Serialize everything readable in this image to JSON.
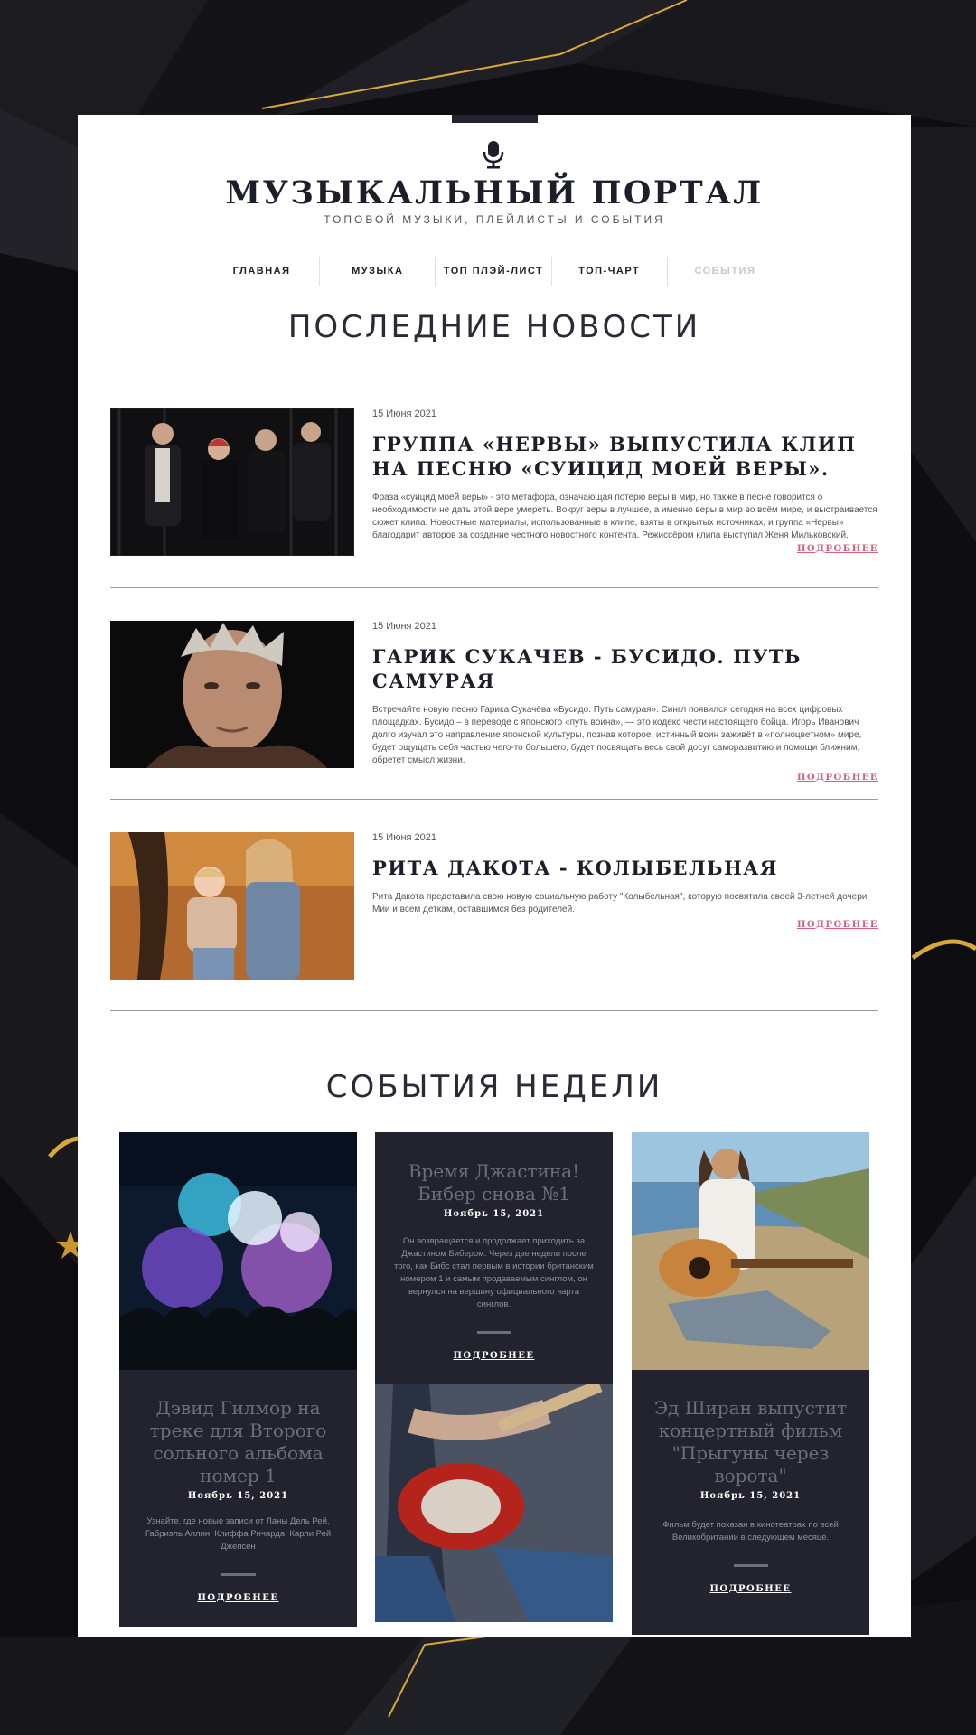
{
  "header": {
    "title": "МУЗЫКАЛЬНЫЙ ПОРТАЛ",
    "subtitle": "ТОПОВОЙ МУЗЫКИ, ПЛЕЙЛИСТЫ И СОБЫТИЯ"
  },
  "nav": {
    "items": [
      {
        "label": "ГЛАВНАЯ"
      },
      {
        "label": "МУЗЫКА"
      },
      {
        "label": "ТОП ПЛЭЙ-ЛИСТ"
      },
      {
        "label": "ТОП-ЧАРТ"
      },
      {
        "label": "СОБЫТИЯ"
      }
    ]
  },
  "news": {
    "section_title": "ПОСЛЕДНИЕ НОВОСТИ",
    "items": [
      {
        "date": "15 Июня 2021",
        "title": "ГРУППА «НЕРВЫ» ВЫПУСТИЛА КЛИП НА ПЕСНЮ «СУИЦИД МОЕЙ ВЕРЫ».",
        "text": "Фраза «суицид моей веры» - это метафора, означающая потерю веры в мир, но также в песне говорится о необходимости не дать этой вере умереть. Вокруг веры в лучшее, а именно веры в мир во всём мире, и выстраивается сюжет клипа. Новостные материалы, использованные в клипе, взяты в открытых источниках, и группа «Нервы» благодарит авторов за создание честного новостного контента. Режиссёром клипа выступил Женя Мильковский.",
        "more": "ПОДРОБНЕЕ",
        "image": "band-photo"
      },
      {
        "date": "15 Июня 2021",
        "title": "ГАРИК СУКАЧЕВ - БУСИДО. ПУТЬ САМУРАЯ",
        "text": "Встречайте новую песню Гарика Сукачёва «Бусидо. Путь самурая». Сингл появился сегодня на всех цифровых площадках. Бусидо – в переводе с японского «путь воина», — это кодекс чести настоящего бойца. Игорь Иванович долго изучал это направление японской культуры, познав которое, истинный воин заживёт в «полноцветном» мире, будет ощущать себя частью чего-то большего, будет посвящать весь свой досуг саморазвитию и помощи ближним, обретет смысл жизни.",
        "more": "ПОДРОБНЕЕ",
        "image": "portrait-photo"
      },
      {
        "date": "15 Июня 2021",
        "title": "РИТА ДАКОТА - КОЛЫБЕЛЬНАЯ",
        "text": "Рита Дакота представила свою новую социальную работу \"Колыбельная\", которую посвятила своей 3-летней дочери Мии и всем деткам, оставшимся без родителей.",
        "more": "ПОДРОБНЕЕ",
        "image": "mother-daughter-photo"
      }
    ]
  },
  "events": {
    "section_title": "СОБЫТИЯ НЕДЕЛИ",
    "items": [
      {
        "title": "Дэвид Гилмор на треке для Второго сольного альбома номер 1",
        "date": "Ноябрь 15, 2021",
        "text": "Узнайте, где новые записи от Ланы Дель Рей, Габриэль Аплин, Клиффа Ричарда, Карли Рей Джепсен",
        "more": "ПОДРОБНЕЕ",
        "image": "concert-crowd-photo"
      },
      {
        "title": "Время Джастина! Бибер снова №1",
        "date": "Ноябрь 15, 2021",
        "text": "Он возвращается и продолжает приходить за Джастином Бибером. Через две недели после того, как Бибс стал первым в истории британским номером 1 и самым продаваемым синглом, он вернулся на вершину официального чарта синглов.",
        "more": "ПОДРОБНЕЕ",
        "image": "electric-guitar-photo"
      },
      {
        "title": "Эд Ширан выпустит концертный фильм \"Прыгуны через ворота\"",
        "date": "Ноябрь 15, 2021",
        "text": "Фильм будет показан в кинотеатрах по всей Великобритании в следующем месяце.",
        "more": "ПОДРОБНЕЕ",
        "image": "acoustic-guitar-photo"
      }
    ]
  },
  "colors": {
    "dark": "#1d1e2b",
    "card": "#22232e",
    "accent": "#d4607a",
    "gold": "#d9a83a"
  }
}
